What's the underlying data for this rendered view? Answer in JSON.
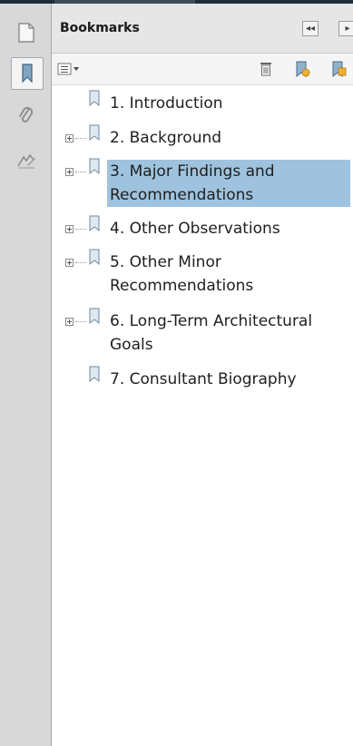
{
  "panel": {
    "title": "Bookmarks"
  },
  "rail": {
    "items": [
      {
        "icon": "page-thumbnails-icon"
      },
      {
        "icon": "bookmark-icon"
      },
      {
        "icon": "paperclip-icon"
      },
      {
        "icon": "signature-icon"
      }
    ]
  },
  "toolbar": {
    "tools": [
      "options-menu-icon",
      "delete-icon",
      "new-bookmark-icon",
      "expand-bookmark-icon"
    ]
  },
  "bookmarks": [
    {
      "label": "1. Introduction",
      "expandable": false,
      "selected": false
    },
    {
      "label": "2. Background",
      "expandable": true,
      "selected": false
    },
    {
      "label": "3. Major Findings and Recommendations",
      "expandable": true,
      "selected": true
    },
    {
      "label": "4. Other Observations",
      "expandable": true,
      "selected": false
    },
    {
      "label": "5. Other Minor Recommendations",
      "expandable": true,
      "selected": false
    },
    {
      "label": "6. Long-Term Architectural Goals",
      "expandable": true,
      "selected": false
    },
    {
      "label": "7. Consultant Biography",
      "expandable": false,
      "selected": false
    }
  ]
}
